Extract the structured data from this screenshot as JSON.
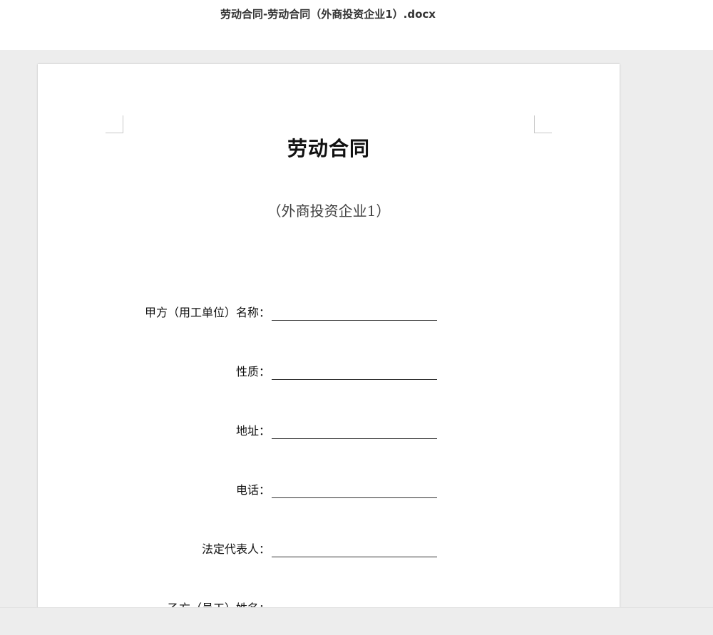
{
  "window": {
    "filename": "劳动合同-劳动合同（外商投资企业1）.docx"
  },
  "document": {
    "title": "劳动合同",
    "subtitle": "（外商投资企业1）",
    "fields": [
      {
        "label": "甲方（用工单位）名称：",
        "value": ""
      },
      {
        "label": "性质：",
        "value": ""
      },
      {
        "label": "地址：",
        "value": ""
      },
      {
        "label": "电话：",
        "value": ""
      },
      {
        "label": "法定代表人：",
        "value": ""
      },
      {
        "label": "乙方（员工）姓名：",
        "value": ""
      }
    ]
  }
}
